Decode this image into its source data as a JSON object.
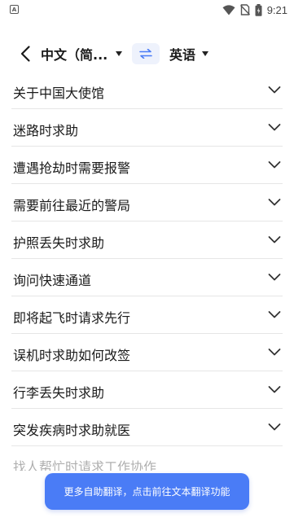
{
  "status_bar": {
    "left_icon": "A",
    "time": "9:21",
    "icons": [
      "wifi-icon",
      "no-sim-icon",
      "battery-icon"
    ]
  },
  "header": {
    "source_language": "中文（简...",
    "target_language": "英语"
  },
  "categories": [
    {
      "label": "关于中国大使馆"
    },
    {
      "label": "迷路时求助"
    },
    {
      "label": "遭遇抢劫时需要报警"
    },
    {
      "label": "需要前往最近的警局"
    },
    {
      "label": "护照丢失时求助"
    },
    {
      "label": "询问快速通道"
    },
    {
      "label": "即将起飞时请求先行"
    },
    {
      "label": "误机时求助如何改签"
    },
    {
      "label": "行李丢失时求助"
    },
    {
      "label": "突发疾病时求助就医"
    }
  ],
  "partial_category": "找人帮忙时请求工作协作",
  "toast": {
    "text": "更多自助翻译，点击前往文本翻译功能"
  },
  "colors": {
    "accent": "#4a7cf6",
    "divider": "#e6e6e6",
    "swap_bg": "#eef2fc"
  }
}
